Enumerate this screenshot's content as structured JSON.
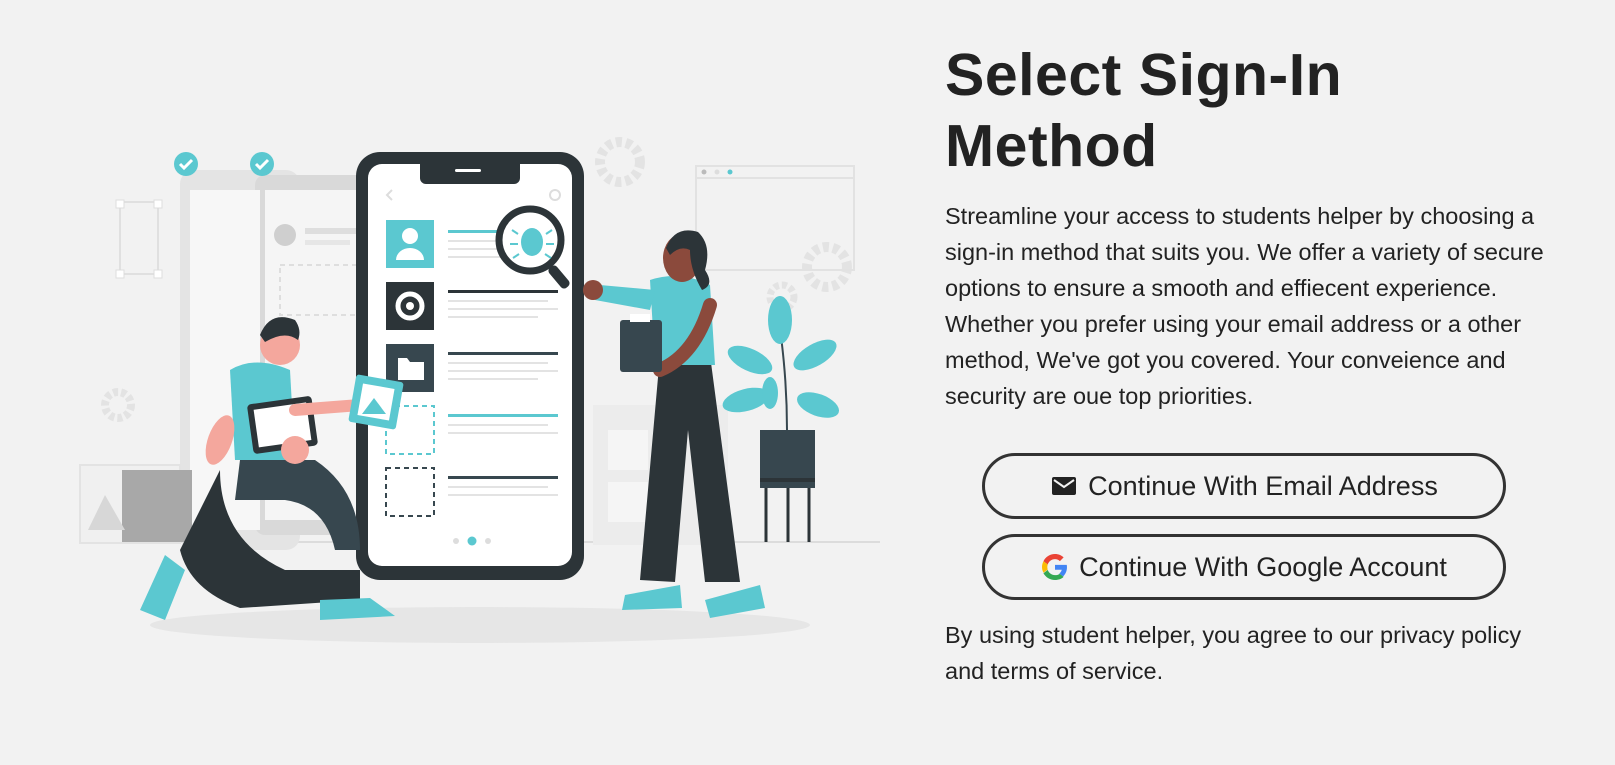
{
  "page": {
    "title": "Select Sign-In Method",
    "description": "Streamline your access to students helper by choosing a sign-in method that suits you. We offer a variety of secure options to ensure a smooth and effiecent experience. Whether you prefer using your email address or a other method, We've got you covered. Your conveience and security are oue top priorities.",
    "legal": "By using student helper, you agree to our privacy policy and terms of service."
  },
  "buttons": {
    "email": {
      "label": "Continue With Email Address",
      "icon": "mail-icon"
    },
    "google": {
      "label": "Continue With Google Account",
      "icon": "google-icon"
    }
  },
  "colors": {
    "accent": "#5bc8d0",
    "dark": "#37474f",
    "background": "#f2f2f2"
  }
}
